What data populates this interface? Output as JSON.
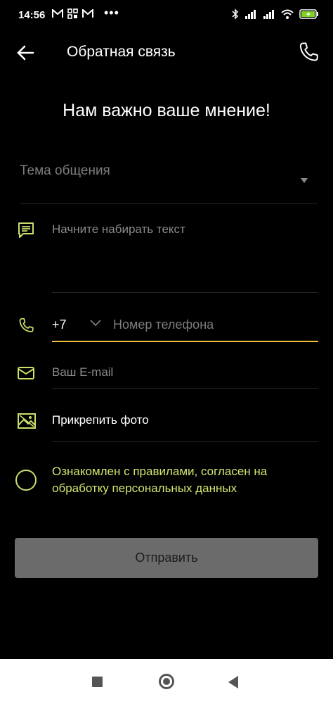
{
  "status_bar": {
    "time": "14:56",
    "left_icons": [
      "gmail-icon",
      "grid-icon",
      "gmail-icon"
    ],
    "dots": "•••",
    "right_icons": [
      "bluetooth-icon",
      "signal-icon",
      "signal-icon",
      "wifi-icon",
      "battery-charging-icon"
    ],
    "battery_color": "#7fd321"
  },
  "app_bar": {
    "title": "Обратная связь",
    "back_icon": "arrow-left-icon",
    "call_icon": "phone-icon"
  },
  "headline": "Нам важно ваше мнение!",
  "form": {
    "topic": {
      "placeholder": "Тема общения",
      "icon": "dropdown-caret-icon"
    },
    "message": {
      "placeholder": "Начните набирать текст",
      "icon": "message-icon"
    },
    "phone": {
      "prefix": "+7",
      "placeholder": "Номер телефона",
      "icon": "phone-icon",
      "focused_color": "#f7c23d"
    },
    "email": {
      "placeholder": "Ваш E-mail",
      "icon": "mail-icon"
    },
    "attach": {
      "label": "Прикрепить фото",
      "icon": "image-icon"
    },
    "consent": {
      "text": "Ознакомлен с правилами, согласен на обработку персональных данных",
      "checked": false
    }
  },
  "submit_label": "Отправить",
  "accent_color": "#c8e06a",
  "nav_bar": {
    "icons": [
      "recents-square-icon",
      "home-circle-icon",
      "back-triangle-icon"
    ]
  }
}
